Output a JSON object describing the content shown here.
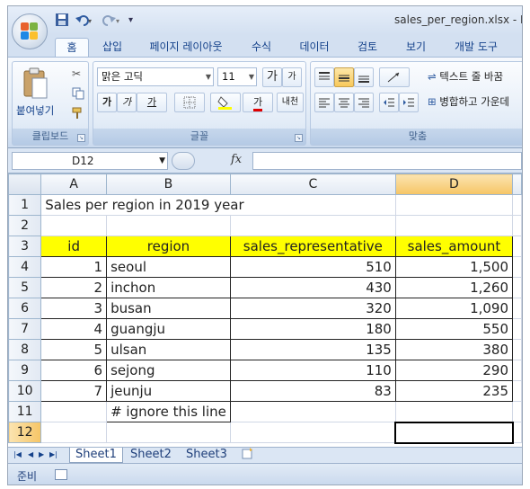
{
  "window": {
    "title": "sales_per_region.xlsx - M"
  },
  "quick_access": {
    "save_icon": "save-icon",
    "undo_icon": "undo-icon",
    "redo_icon": "redo-icon",
    "customize": "▾"
  },
  "ribbon": {
    "tabs": [
      {
        "label": "홈",
        "active": true
      },
      {
        "label": "삽입"
      },
      {
        "label": "페이지 레이아웃"
      },
      {
        "label": "수식"
      },
      {
        "label": "데이터"
      },
      {
        "label": "검토"
      },
      {
        "label": "보기"
      },
      {
        "label": "개발 도구"
      }
    ],
    "clipboard": {
      "paste_label": "붙여넣기",
      "group_label": "클립보드"
    },
    "font": {
      "name": "맑은 고딕",
      "size": "11",
      "grow": "가",
      "shrink": "가",
      "bold": "가",
      "italic": "가",
      "underline": "가",
      "font_color_char": "가",
      "phonetic": "내천",
      "group_label": "글꼴"
    },
    "alignment": {
      "wrap_text": "텍스트 줄 바꿈",
      "merge_center": "병합하고 가운데",
      "group_label": "맞춤"
    }
  },
  "formula_bar": {
    "name_box": "D12",
    "fx_label": "fx",
    "formula": ""
  },
  "sheet": {
    "columns": [
      "A",
      "B",
      "C",
      "D"
    ],
    "selected_column": "D",
    "selected_row": "12",
    "title": "Sales per region in 2019 year",
    "headers": [
      "id",
      "region",
      "sales_representative",
      "sales_amount"
    ],
    "rows": [
      [
        "1",
        "seoul",
        "510",
        "1,500"
      ],
      [
        "2",
        "inchon",
        "430",
        "1,260"
      ],
      [
        "3",
        "busan",
        "320",
        "1,090"
      ],
      [
        "4",
        "guangju",
        "180",
        "550"
      ],
      [
        "5",
        "ulsan",
        "135",
        "380"
      ],
      [
        "6",
        "sejong",
        "110",
        "290"
      ],
      [
        "7",
        "jeunju",
        "83",
        "235"
      ]
    ],
    "note": "# ignore this line",
    "row_numbers": [
      "1",
      "2",
      "3",
      "4",
      "5",
      "6",
      "7",
      "8",
      "9",
      "10",
      "11",
      "12"
    ]
  },
  "sheet_tabs": [
    "Sheet1",
    "Sheet2",
    "Sheet3"
  ],
  "status": {
    "text": "준비"
  },
  "colors": {
    "header_fill": "#ffff00",
    "selection_orange": "#f6c565",
    "ribbon_blue": "#dbe6f4"
  }
}
